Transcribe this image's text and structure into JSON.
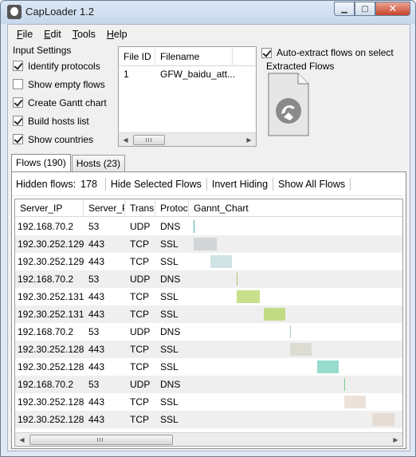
{
  "window": {
    "title": "CapLoader 1.2",
    "minimize_glyph": "▁",
    "maximize_glyph": "▢",
    "close_glyph": "✕"
  },
  "menu": [
    {
      "label": "File",
      "accel": "F",
      "rest": "ile"
    },
    {
      "label": "Edit",
      "accel": "E",
      "rest": "dit"
    },
    {
      "label": "Tools",
      "accel": "T",
      "rest": "ools"
    },
    {
      "label": "Help",
      "accel": "H",
      "rest": "elp"
    }
  ],
  "input_settings": {
    "title": "Input Settings",
    "options": [
      {
        "label": "Identify protocols",
        "checked": true
      },
      {
        "label": "Show empty flows",
        "checked": false
      },
      {
        "label": "Create Gantt chart",
        "checked": true
      },
      {
        "label": "Build hosts list",
        "checked": true
      },
      {
        "label": "Show countries",
        "checked": true
      }
    ]
  },
  "file_list": {
    "headers": [
      "File ID",
      "Filename"
    ],
    "rows": [
      {
        "id": "1",
        "filename": "GFW_baidu_att..."
      }
    ]
  },
  "extract": {
    "auto_extract_label": "Auto-extract flows on select",
    "auto_extract_checked": true,
    "extracted_label": "Extracted Flows",
    "icon": "pcap-file-icon"
  },
  "tabs": [
    {
      "label": "Flows (190)",
      "active": true
    },
    {
      "label": "Hosts (23)",
      "active": false
    }
  ],
  "toolbar": {
    "hidden_flows_label": "Hidden flows:",
    "hidden_flows_value": "178",
    "hide_selected": "Hide Selected Flows",
    "invert_hiding": "Invert Hiding",
    "show_all": "Show All Flows"
  },
  "flows": {
    "headers": [
      "Server_IP",
      "Server_P",
      "Transp",
      "Protoco",
      "Gannt_Chart"
    ],
    "rows": [
      {
        "ip": "192.168.70.2",
        "port": "53",
        "transport": "UDP",
        "protocol": "DNS",
        "gantt_start": 0.0,
        "gantt_len": 0.004,
        "color": "#44a9a9"
      },
      {
        "ip": "192.30.252.129",
        "port": "443",
        "transport": "TCP",
        "protocol": "SSL",
        "gantt_start": 0.0,
        "gantt_len": 0.11,
        "color": "#d2d6d8"
      },
      {
        "ip": "192.30.252.129",
        "port": "443",
        "transport": "TCP",
        "protocol": "SSL",
        "gantt_start": 0.08,
        "gantt_len": 0.105,
        "color": "#cfe2e4"
      },
      {
        "ip": "192.168.70.2",
        "port": "53",
        "transport": "UDP",
        "protocol": "DNS",
        "gantt_start": 0.205,
        "gantt_len": 0.004,
        "color": "#a8c46a"
      },
      {
        "ip": "192.30.252.131",
        "port": "443",
        "transport": "TCP",
        "protocol": "SSL",
        "gantt_start": 0.205,
        "gantt_len": 0.11,
        "color": "#c9e08a"
      },
      {
        "ip": "192.30.252.131",
        "port": "443",
        "transport": "TCP",
        "protocol": "SSL",
        "gantt_start": 0.335,
        "gantt_len": 0.105,
        "color": "#c2dc86"
      },
      {
        "ip": "192.168.70.2",
        "port": "53",
        "transport": "UDP",
        "protocol": "DNS",
        "gantt_start": 0.46,
        "gantt_len": 0.004,
        "color": "#a9c7c0"
      },
      {
        "ip": "192.30.252.128",
        "port": "443",
        "transport": "TCP",
        "protocol": "SSL",
        "gantt_start": 0.46,
        "gantt_len": 0.105,
        "color": "#dcdcd2"
      },
      {
        "ip": "192.30.252.128",
        "port": "443",
        "transport": "TCP",
        "protocol": "SSL",
        "gantt_start": 0.59,
        "gantt_len": 0.105,
        "color": "#97dccd"
      },
      {
        "ip": "192.168.70.2",
        "port": "53",
        "transport": "UDP",
        "protocol": "DNS",
        "gantt_start": 0.72,
        "gantt_len": 0.004,
        "color": "#7ccc95"
      },
      {
        "ip": "192.30.252.128",
        "port": "443",
        "transport": "TCP",
        "protocol": "SSL",
        "gantt_start": 0.72,
        "gantt_len": 0.105,
        "color": "#ece2da"
      },
      {
        "ip": "192.30.252.128",
        "port": "443",
        "transport": "TCP",
        "protocol": "SSL",
        "gantt_start": 0.855,
        "gantt_len": 0.105,
        "color": "#e7dcd3"
      }
    ]
  }
}
